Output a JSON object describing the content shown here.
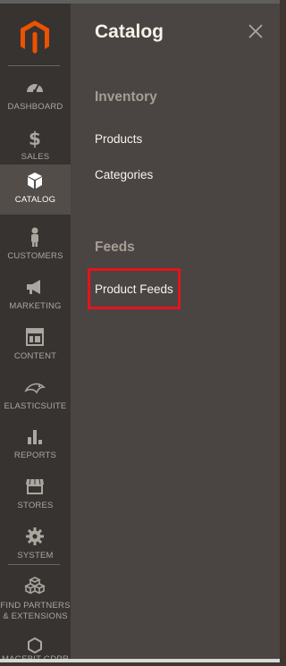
{
  "colors": {
    "sidebar_bg": "#373330",
    "panel_bg": "#4a4542",
    "brand_orange": "#eb5202",
    "highlight_red": "#e2151b"
  },
  "sidebar": {
    "logo_icon": "magento-logo",
    "items": [
      {
        "label": "DASHBOARD",
        "icon": "dashboard-icon"
      },
      {
        "label": "SALES",
        "icon": "dollar-icon"
      },
      {
        "label": "CATALOG",
        "icon": "box-icon",
        "active": true
      },
      {
        "label": "CUSTOMERS",
        "icon": "person-icon"
      },
      {
        "label": "MARKETING",
        "icon": "megaphone-icon"
      },
      {
        "label": "CONTENT",
        "icon": "layout-icon"
      },
      {
        "label": "ELASTICSUITE",
        "icon": "elasticsuite-icon"
      },
      {
        "label": "REPORTS",
        "icon": "bar-chart-icon"
      },
      {
        "label": "STORES",
        "icon": "store-icon"
      },
      {
        "label": "SYSTEM",
        "icon": "gear-icon"
      },
      {
        "label": "FIND PARTNERS\n& EXTENSIONS",
        "icon": "cubes-icon"
      },
      {
        "label": "MAGEBIT GDPR",
        "icon": "hexagon-icon"
      }
    ]
  },
  "panel": {
    "title": "Catalog",
    "close_icon": "close-icon",
    "sections": [
      {
        "title": "Inventory",
        "links": [
          "Products",
          "Categories"
        ]
      },
      {
        "title": "Feeds",
        "links": [
          "Product Feeds"
        ]
      }
    ]
  }
}
